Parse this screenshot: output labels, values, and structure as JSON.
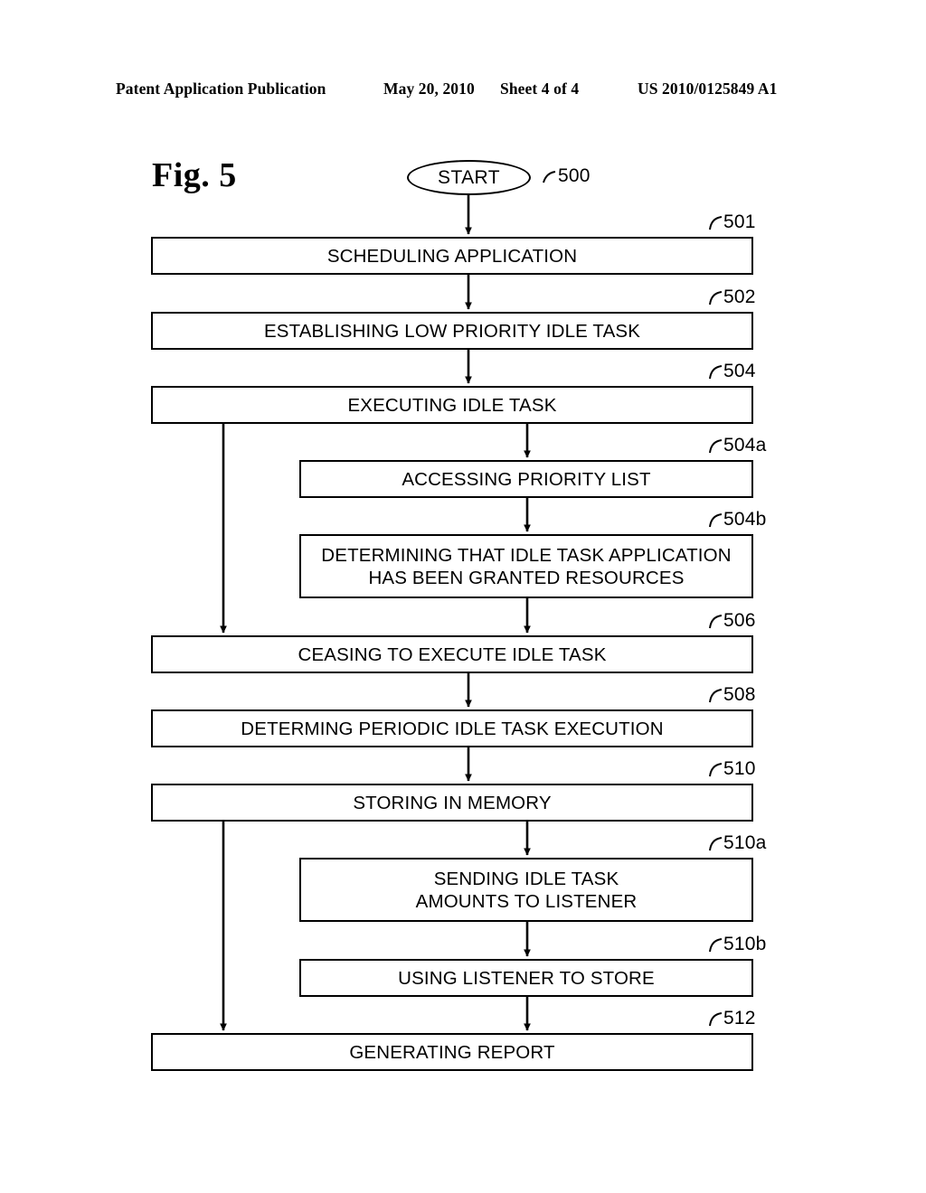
{
  "header": {
    "publication": "Patent Application Publication",
    "date": "May 20, 2010",
    "sheet": "Sheet 4 of 4",
    "patent_number": "US 2010/0125849 A1"
  },
  "figure": {
    "title": "Fig. 5",
    "start_label": "START",
    "start_ref": "500"
  },
  "nodes": [
    {
      "ref": "501",
      "text": "SCHEDULING APPLICATION",
      "indent": false
    },
    {
      "ref": "502",
      "text": "ESTABLISHING LOW PRIORITY IDLE TASK",
      "indent": false
    },
    {
      "ref": "504",
      "text": "EXECUTING IDLE TASK",
      "indent": false
    },
    {
      "ref": "504a",
      "text": "ACCESSING PRIORITY LIST",
      "indent": true
    },
    {
      "ref": "504b",
      "text": "DETERMINING THAT IDLE TASK APPLICATION\nHAS BEEN GRANTED RESOURCES",
      "indent": true
    },
    {
      "ref": "506",
      "text": "CEASING TO EXECUTE IDLE TASK",
      "indent": false
    },
    {
      "ref": "508",
      "text": "DETERMING PERIODIC IDLE TASK EXECUTION",
      "indent": false
    },
    {
      "ref": "510",
      "text": "STORING IN MEMORY",
      "indent": false
    },
    {
      "ref": "510a",
      "text": "SENDING IDLE TASK\nAMOUNTS TO LISTENER",
      "indent": true
    },
    {
      "ref": "510b",
      "text": "USING LISTENER TO STORE",
      "indent": true
    },
    {
      "ref": "512",
      "text": "GENERATING REPORT",
      "indent": false
    }
  ],
  "colors": {
    "ink": "#000000",
    "paper": "#ffffff"
  }
}
